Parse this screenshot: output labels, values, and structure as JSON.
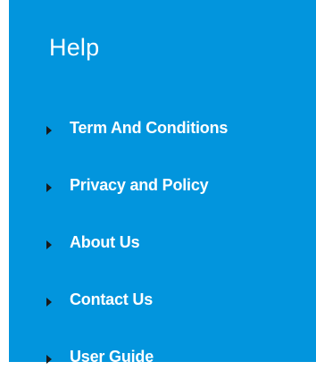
{
  "help": {
    "title": "Help",
    "items": [
      {
        "label": "Term And Conditions",
        "icon": "caret-right-icon"
      },
      {
        "label": "Privacy and Policy",
        "icon": "caret-right-icon"
      },
      {
        "label": "About Us",
        "icon": "caret-right-icon"
      },
      {
        "label": "Contact Us",
        "icon": "caret-right-icon"
      },
      {
        "label": "User Guide",
        "icon": "caret-right-icon"
      }
    ]
  },
  "colors": {
    "panel_background": "#0295dd",
    "text": "#ffffff",
    "bullet": "#1a1a1a"
  }
}
